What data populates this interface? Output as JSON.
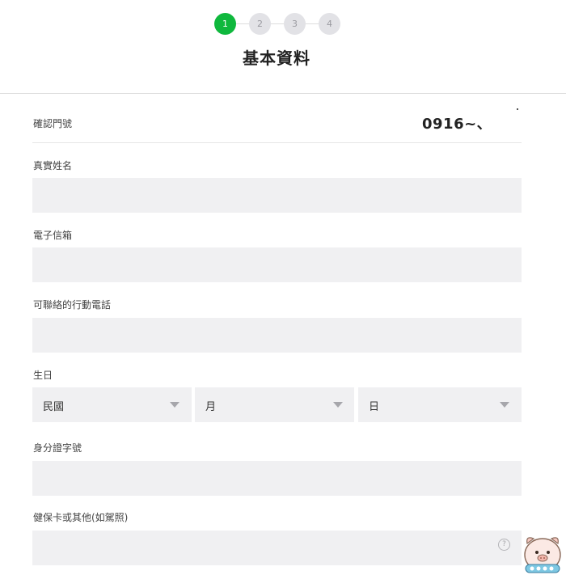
{
  "stepper": {
    "steps": [
      "1",
      "2",
      "3",
      "4"
    ],
    "active_step": "1"
  },
  "page_title": "基本資料",
  "form": {
    "phone_verify": {
      "label": "確認門號",
      "value": "0916~、"
    },
    "real_name": {
      "label": "真實姓名",
      "value": ""
    },
    "email": {
      "label": "電子信箱",
      "value": ""
    },
    "mobile": {
      "label": "可聯絡的行動電話",
      "value": ""
    },
    "birthday": {
      "label": "生日",
      "year_select": "民國",
      "month_select": "月",
      "day_select": "日"
    },
    "id_number": {
      "label": "身分證字號",
      "value": ""
    },
    "health_card": {
      "label": "健保卡或其他(如駕照)",
      "value": ""
    }
  },
  "help_icon_glyph": "?",
  "colors": {
    "active_step": "#0fb83d",
    "inactive_step": "#e2e2e6",
    "input_background": "#f0f0f2"
  },
  "icons": {
    "help": "question-circle-icon",
    "dropdown": "chevron-down-icon",
    "mascot": "mascot-watermark-icon"
  }
}
